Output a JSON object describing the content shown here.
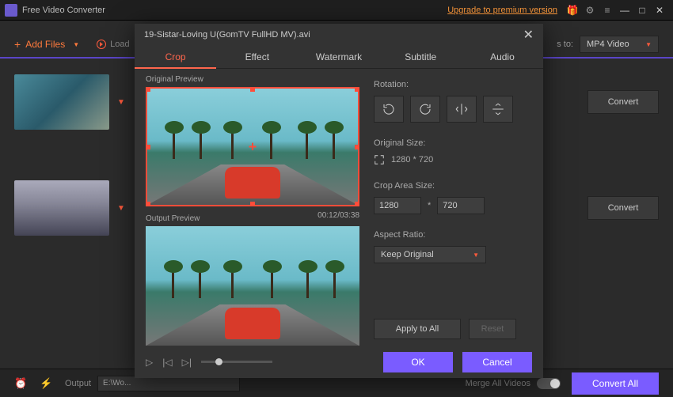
{
  "app": {
    "title": "Free Video Converter",
    "upgrade": "Upgrade to premium version"
  },
  "toolbar": {
    "add_files": "Add Files",
    "load": "Load",
    "convert_to_label": "s to:",
    "format_selected": "MP4 Video"
  },
  "filelist": {
    "convert_label": "Convert"
  },
  "bottom": {
    "output_label": "Output",
    "output_path": "E:\\Wo...",
    "merge_label": "Merge All Videos",
    "convert_all": "Convert All"
  },
  "modal": {
    "title": "19-Sistar-Loving U(GomTV FullHD MV).avi",
    "tabs": {
      "crop": "Crop",
      "effect": "Effect",
      "watermark": "Watermark",
      "subtitle": "Subtitle",
      "audio": "Audio"
    },
    "original_preview_label": "Original Preview",
    "output_preview_label": "Output Preview",
    "timecode": "00:12/03:38",
    "rotation_label": "Rotation:",
    "original_size_label": "Original Size:",
    "original_size_value": "1280 * 720",
    "crop_area_label": "Crop Area Size:",
    "crop_w": "1280",
    "crop_h": "720",
    "aspect_label": "Aspect Ratio:",
    "aspect_value": "Keep Original",
    "apply_all": "Apply to All",
    "reset": "Reset",
    "ok": "OK",
    "cancel": "Cancel"
  }
}
